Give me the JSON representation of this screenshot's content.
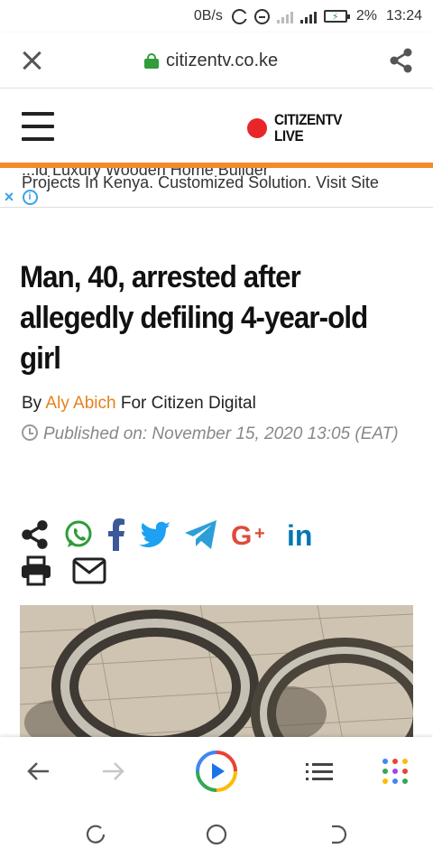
{
  "status_bar": {
    "net_speed": "0B/s",
    "battery_pct": "2%",
    "time": "13:24"
  },
  "browser": {
    "url": "citizentv.co.ke"
  },
  "site": {
    "logo_line1": "CITIZENTV",
    "logo_line2": "LIVE"
  },
  "ad": {
    "text": "Projects In Kenya. Customized Solution. Visit Site",
    "partial_text": "...ld Luxury Wooden Home Builder"
  },
  "article": {
    "headline": "Man, 40, arrested after allegedly defiling 4-year-old girl",
    "by_label": "By",
    "author": "Aly Abich",
    "outlet": "For Citizen Digital",
    "published": "Published on:  November 15, 2020 13:05 (EAT)"
  },
  "colors": {
    "accent_orange": "#f28c28",
    "author_orange": "#e6801e",
    "logo_red": "#e8262a",
    "whatsapp": "#2e9d3a",
    "facebook": "#3b5998",
    "twitter": "#1da1f2",
    "telegram": "#2c9fd8",
    "google": "#dd4b39",
    "linkedin": "#0077b5"
  }
}
